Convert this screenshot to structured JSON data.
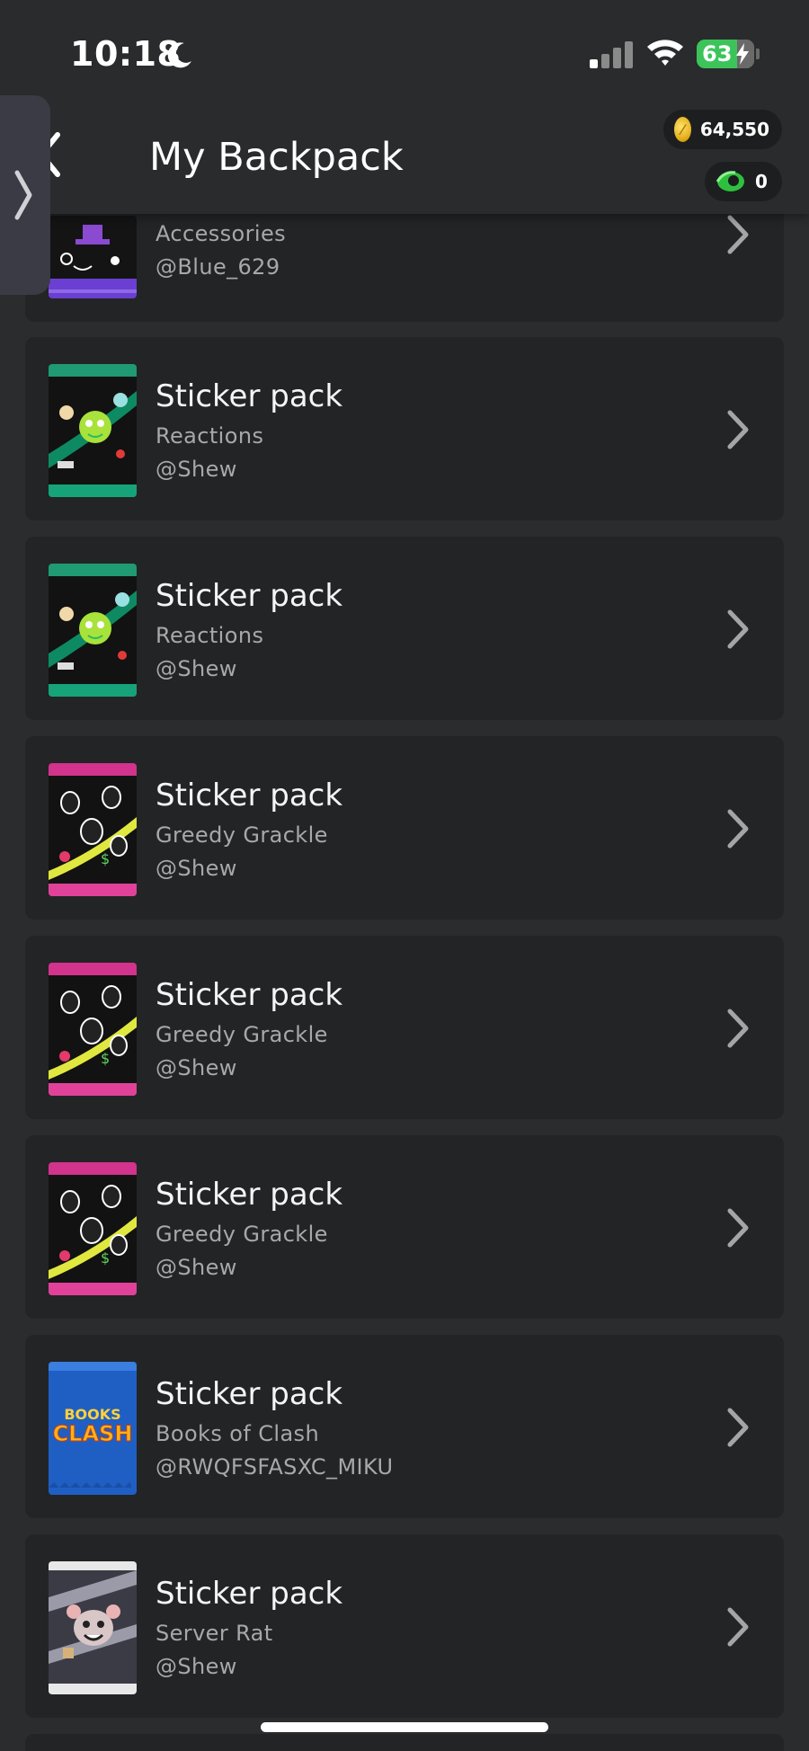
{
  "status_bar": {
    "time": "10:18",
    "battery_level": "63"
  },
  "header": {
    "title": "My Backpack"
  },
  "currencies": {
    "gold": "64,550",
    "orbs": "0"
  },
  "items": [
    {
      "title": "",
      "subtitle": "Accessories",
      "owner": "@Blue_629",
      "pack_color": "#6b3fd1"
    },
    {
      "title": "Sticker pack",
      "subtitle": "Reactions",
      "owner": "@Shew",
      "pack_color": "#1f9a72"
    },
    {
      "title": "Sticker pack",
      "subtitle": "Reactions",
      "owner": "@Shew",
      "pack_color": "#1f9a72"
    },
    {
      "title": "Sticker pack",
      "subtitle": "Greedy Grackle",
      "owner": "@Shew",
      "pack_color": "#d2338c"
    },
    {
      "title": "Sticker pack",
      "subtitle": "Greedy Grackle",
      "owner": "@Shew",
      "pack_color": "#d2338c"
    },
    {
      "title": "Sticker pack",
      "subtitle": "Greedy Grackle",
      "owner": "@Shew",
      "pack_color": "#d2338c"
    },
    {
      "title": "Sticker pack",
      "subtitle": "Books of Clash",
      "owner": "@RWQFSFASXC_MIKU",
      "pack_color": "#1f5fc4",
      "pack_art_text": [
        "BOOKS",
        "CLASH"
      ]
    },
    {
      "title": "Sticker pack",
      "subtitle": "Server Rat",
      "owner": "@Shew",
      "pack_color": "#e8e8e8"
    }
  ]
}
